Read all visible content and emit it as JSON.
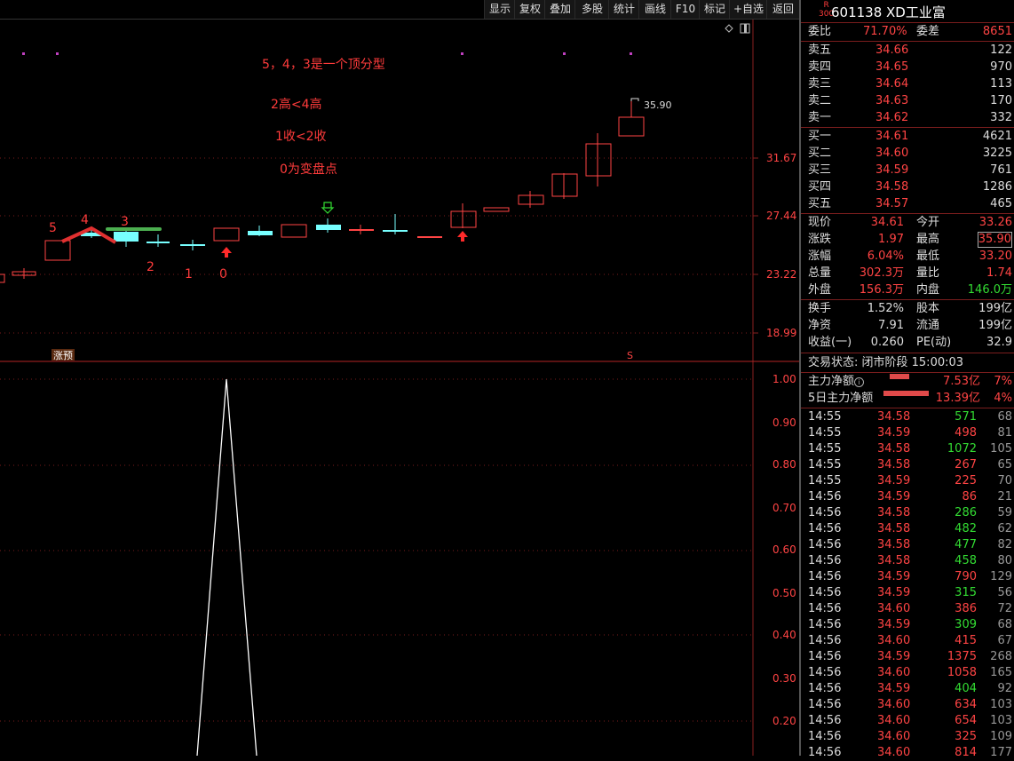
{
  "toolbar": {
    "buttons": [
      "显示",
      "复权",
      "叠加",
      "多股",
      "统计",
      "画线",
      "F10",
      "标记",
      "+自选",
      "返回"
    ]
  },
  "chart": {
    "annotations": [
      "5，4，3是一个顶分型",
      "2高<4高",
      "1收<2收",
      "0为变盘点"
    ],
    "candle_labels": [
      "5",
      "4",
      "3",
      "2",
      "1",
      "0"
    ],
    "price_axis": [
      "31.67",
      "27.44",
      "23.22",
      "18.99"
    ],
    "high_label": "35.90",
    "badge": "涨预",
    "s_marker": "S",
    "indicator_axis": [
      "1.00",
      "0.90",
      "0.80",
      "0.70",
      "0.60",
      "0.50",
      "0.40",
      "0.30",
      "0.20"
    ]
  },
  "chart_data": {
    "type": "line",
    "title": "",
    "ylim": [
      0,
      1
    ],
    "series": [
      {
        "values": [
          0,
          1,
          0
        ]
      }
    ]
  },
  "stock": {
    "r_mark": "R",
    "r_sub": "300",
    "code_name": "601138 XD工业富"
  },
  "weibi": {
    "label": "委比",
    "value": "71.70%",
    "label2": "委差",
    "value2": "8651"
  },
  "asks": [
    {
      "label": "卖五",
      "price": "34.66",
      "vol": "122"
    },
    {
      "label": "卖四",
      "price": "34.65",
      "vol": "970"
    },
    {
      "label": "卖三",
      "price": "34.64",
      "vol": "113"
    },
    {
      "label": "卖二",
      "price": "34.63",
      "vol": "170"
    },
    {
      "label": "卖一",
      "price": "34.62",
      "vol": "332"
    }
  ],
  "bids": [
    {
      "label": "买一",
      "price": "34.61",
      "vol": "4621"
    },
    {
      "label": "买二",
      "price": "34.60",
      "vol": "3225"
    },
    {
      "label": "买三",
      "price": "34.59",
      "vol": "761"
    },
    {
      "label": "买四",
      "price": "34.58",
      "vol": "1286"
    },
    {
      "label": "买五",
      "price": "34.57",
      "vol": "465"
    }
  ],
  "quote": [
    {
      "l1": "现价",
      "v1": "34.61",
      "l2": "今开",
      "v2": "33.26"
    },
    {
      "l1": "涨跌",
      "v1": "1.97",
      "l2": "最高",
      "v2": "35.90"
    },
    {
      "l1": "涨幅",
      "v1": "6.04%",
      "l2": "最低",
      "v2": "33.20"
    },
    {
      "l1": "总量",
      "v1": "302.3万",
      "l2": "量比",
      "v2": "1.74"
    },
    {
      "l1": "外盘",
      "v1": "156.3万",
      "l2": "内盘",
      "v2": "146.0万"
    }
  ],
  "fund": [
    {
      "l1": "换手",
      "v1": "1.52%",
      "l2": "股本",
      "v2": "199亿"
    },
    {
      "l1": "净资",
      "v1": "7.91",
      "l2": "流通",
      "v2": "199亿"
    },
    {
      "l1": "收益(一)",
      "v1": "0.260",
      "l2": "PE(动)",
      "v2": "32.9"
    }
  ],
  "status": "交易状态: 闭市阶段 15:00:03",
  "flow": [
    {
      "label": "主力净额",
      "value": "7.53亿",
      "pct": "7%"
    },
    {
      "label": "5日主力净额",
      "value": "13.39亿",
      "pct": "4%"
    }
  ],
  "ticks": [
    {
      "t": "14:55",
      "p": "34.58",
      "v": "571",
      "n": "68",
      "c": "green"
    },
    {
      "t": "14:55",
      "p": "34.59",
      "v": "498",
      "n": "81",
      "c": "red"
    },
    {
      "t": "14:55",
      "p": "34.58",
      "v": "1072",
      "n": "105",
      "c": "green"
    },
    {
      "t": "14:55",
      "p": "34.58",
      "v": "267",
      "n": "65",
      "c": "red"
    },
    {
      "t": "14:55",
      "p": "34.59",
      "v": "225",
      "n": "70",
      "c": "red"
    },
    {
      "t": "14:56",
      "p": "34.59",
      "v": "86",
      "n": "21",
      "c": "red"
    },
    {
      "t": "14:56",
      "p": "34.58",
      "v": "286",
      "n": "59",
      "c": "green"
    },
    {
      "t": "14:56",
      "p": "34.58",
      "v": "482",
      "n": "62",
      "c": "green"
    },
    {
      "t": "14:56",
      "p": "34.58",
      "v": "477",
      "n": "82",
      "c": "green"
    },
    {
      "t": "14:56",
      "p": "34.58",
      "v": "458",
      "n": "80",
      "c": "green"
    },
    {
      "t": "14:56",
      "p": "34.59",
      "v": "790",
      "n": "129",
      "c": "red"
    },
    {
      "t": "14:56",
      "p": "34.59",
      "v": "315",
      "n": "56",
      "c": "green"
    },
    {
      "t": "14:56",
      "p": "34.60",
      "v": "386",
      "n": "72",
      "c": "red"
    },
    {
      "t": "14:56",
      "p": "34.59",
      "v": "309",
      "n": "68",
      "c": "green"
    },
    {
      "t": "14:56",
      "p": "34.60",
      "v": "415",
      "n": "67",
      "c": "red"
    },
    {
      "t": "14:56",
      "p": "34.59",
      "v": "1375",
      "n": "268",
      "c": "red"
    },
    {
      "t": "14:56",
      "p": "34.60",
      "v": "1058",
      "n": "165",
      "c": "red"
    },
    {
      "t": "14:56",
      "p": "34.59",
      "v": "404",
      "n": "92",
      "c": "green"
    },
    {
      "t": "14:56",
      "p": "34.60",
      "v": "634",
      "n": "103",
      "c": "red"
    },
    {
      "t": "14:56",
      "p": "34.60",
      "v": "654",
      "n": "103",
      "c": "red"
    },
    {
      "t": "14:56",
      "p": "34.60",
      "v": "325",
      "n": "109",
      "c": "red"
    },
    {
      "t": "14:56",
      "p": "34.60",
      "v": "814",
      "n": "177",
      "c": "red"
    }
  ]
}
